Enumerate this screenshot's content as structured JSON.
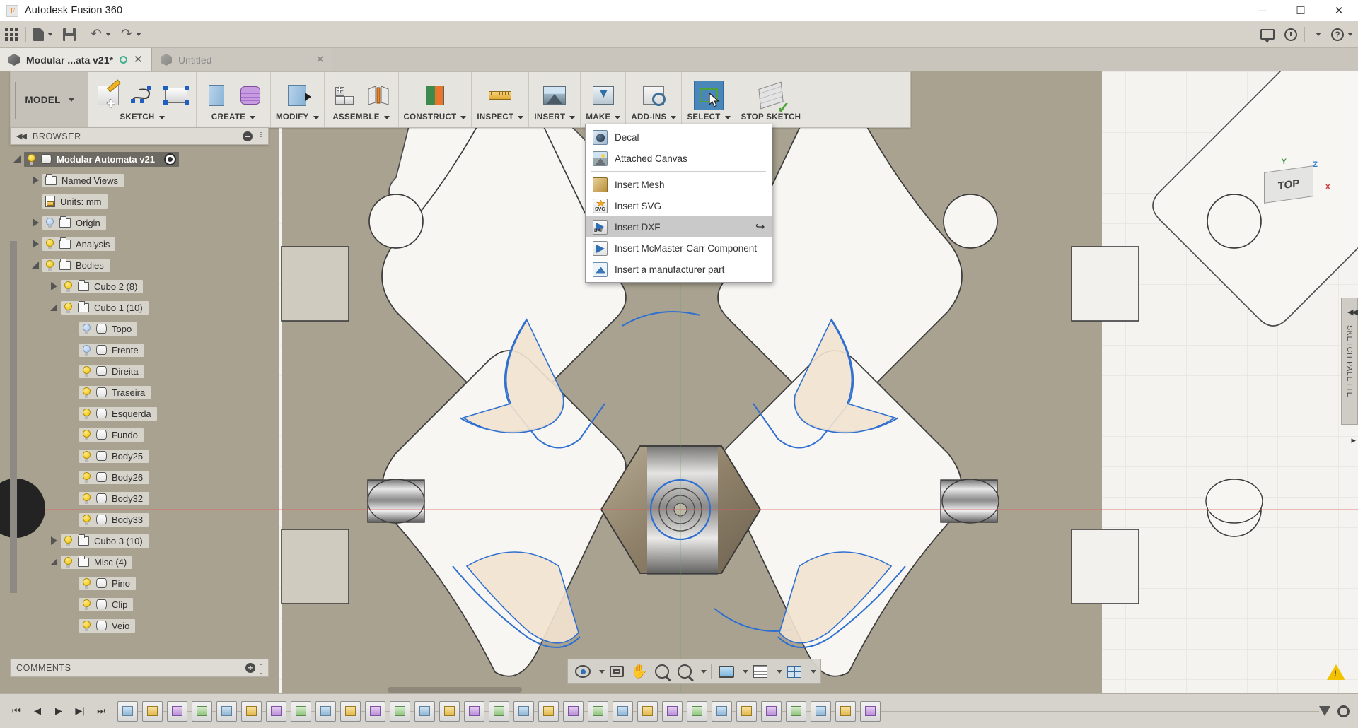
{
  "window": {
    "app_title": "Autodesk Fusion 360",
    "logo_letter": "F",
    "minimize": "─",
    "maximize": "☐",
    "close": "✕"
  },
  "quickbar": {
    "apps_grid": "apps-grid",
    "new_doc": "new-document",
    "save": "save",
    "undo": "undo",
    "redo": "redo",
    "comments_icon": "comments",
    "history_icon": "job-status",
    "user_caret": "▾",
    "help_label": "?",
    "help_caret": "▾"
  },
  "tabs": [
    {
      "label": "Modular ...ata v21*",
      "state": "active",
      "close": "✕",
      "dot": "sync-dot"
    },
    {
      "label": "Untitled",
      "state": "inactive",
      "close": "✕"
    }
  ],
  "ribbon": {
    "workspace": "MODEL",
    "workspace_caret": "▾",
    "groups": [
      {
        "label": "SKETCH",
        "caret": "▾",
        "icons": [
          "create-sketch-icon",
          "spline-icon",
          "rectangle-icon"
        ]
      },
      {
        "label": "CREATE",
        "caret": "▾",
        "icons": [
          "extrude-icon",
          "form-icon"
        ]
      },
      {
        "label": "MODIFY",
        "caret": "▾",
        "icons": [
          "press-pull-icon"
        ]
      },
      {
        "label": "ASSEMBLE",
        "caret": "▾",
        "icons": [
          "new-component-icon",
          "joint-icon"
        ]
      },
      {
        "label": "CONSTRUCT",
        "caret": "▾",
        "icons": [
          "offset-plane-icon"
        ]
      },
      {
        "label": "INSPECT",
        "caret": "▾",
        "icons": [
          "measure-icon"
        ]
      },
      {
        "label": "INSERT",
        "caret": "▾",
        "icons": [
          "insert-icon"
        ]
      },
      {
        "label": "MAKE",
        "caret": "▾",
        "icons": [
          "3d-print-icon"
        ]
      },
      {
        "label": "ADD-INS",
        "caret": "▾",
        "icons": [
          "scripts-addins-icon"
        ]
      },
      {
        "label": "SELECT",
        "caret": "▾",
        "icons": [
          "select-icon"
        ],
        "selected": true
      },
      {
        "label": "STOP SKETCH",
        "caret": "",
        "icons": [
          "stop-sketch-icon"
        ]
      }
    ]
  },
  "insert_menu": {
    "items": [
      {
        "label": "Decal",
        "icon": "decal-icon",
        "highlighted": false,
        "separator_after": false
      },
      {
        "label": "Attached Canvas",
        "icon": "attached-canvas-icon",
        "highlighted": false,
        "separator_after": true
      },
      {
        "label": "Insert Mesh",
        "icon": "insert-mesh-icon",
        "highlighted": false,
        "separator_after": false
      },
      {
        "label": "Insert SVG",
        "icon": "insert-svg-icon",
        "highlighted": false,
        "separator_after": false
      },
      {
        "label": "Insert DXF",
        "icon": "insert-dxf-icon",
        "highlighted": true,
        "separator_after": false,
        "shortcut_glyph": "↩"
      },
      {
        "label": "Insert McMaster-Carr Component",
        "icon": "insert-mcmaster-icon",
        "highlighted": false,
        "separator_after": false
      },
      {
        "label": "Insert a manufacturer part",
        "icon": "insert-manufacturer-icon",
        "highlighted": false,
        "separator_after": false
      }
    ]
  },
  "browser": {
    "title": "BROWSER",
    "collapse_glyph": "◀◀",
    "minimize_glyph": "−",
    "tree": [
      {
        "label": "Modular Automata v21",
        "depth": 0,
        "twisty": "expanded",
        "icon": "component-icon",
        "bulb": "on",
        "root": true,
        "target": true
      },
      {
        "label": "Named Views",
        "depth": 1,
        "twisty": "collapsed",
        "icon": "folder-icon",
        "bulb": "none"
      },
      {
        "label": "Units: mm",
        "depth": 1,
        "twisty": "none",
        "icon": "units-icon",
        "bulb": "none"
      },
      {
        "label": "Origin",
        "depth": 1,
        "twisty": "collapsed",
        "icon": "folder-icon",
        "bulb": "off"
      },
      {
        "label": "Analysis",
        "depth": 1,
        "twisty": "collapsed",
        "icon": "folder-icon",
        "bulb": "on"
      },
      {
        "label": "Bodies",
        "depth": 1,
        "twisty": "expanded",
        "icon": "folder-icon",
        "bulb": "on"
      },
      {
        "label": "Cubo 2 (8)",
        "depth": 2,
        "twisty": "collapsed",
        "icon": "folder-icon",
        "bulb": "on"
      },
      {
        "label": "Cubo 1 (10)",
        "depth": 2,
        "twisty": "expanded",
        "icon": "folder-icon",
        "bulb": "on"
      },
      {
        "label": "Topo",
        "depth": 3,
        "twisty": "none",
        "icon": "body-icon",
        "bulb": "off"
      },
      {
        "label": "Frente",
        "depth": 3,
        "twisty": "none",
        "icon": "body-icon",
        "bulb": "off"
      },
      {
        "label": "Direita",
        "depth": 3,
        "twisty": "none",
        "icon": "body-icon",
        "bulb": "on"
      },
      {
        "label": "Traseira",
        "depth": 3,
        "twisty": "none",
        "icon": "body-icon",
        "bulb": "on"
      },
      {
        "label": "Esquerda",
        "depth": 3,
        "twisty": "none",
        "icon": "body-icon",
        "bulb": "on"
      },
      {
        "label": "Fundo",
        "depth": 3,
        "twisty": "none",
        "icon": "body-icon",
        "bulb": "on"
      },
      {
        "label": "Body25",
        "depth": 3,
        "twisty": "none",
        "icon": "body-icon",
        "bulb": "on"
      },
      {
        "label": "Body26",
        "depth": 3,
        "twisty": "none",
        "icon": "body-icon",
        "bulb": "on"
      },
      {
        "label": "Body32",
        "depth": 3,
        "twisty": "none",
        "icon": "body-icon",
        "bulb": "on"
      },
      {
        "label": "Body33",
        "depth": 3,
        "twisty": "none",
        "icon": "body-icon",
        "bulb": "on"
      },
      {
        "label": "Cubo 3 (10)",
        "depth": 2,
        "twisty": "collapsed",
        "icon": "folder-icon",
        "bulb": "on"
      },
      {
        "label": "Misc (4)",
        "depth": 2,
        "twisty": "expanded",
        "icon": "folder-icon",
        "bulb": "on"
      },
      {
        "label": "Pino",
        "depth": 3,
        "twisty": "none",
        "icon": "body-icon",
        "bulb": "on"
      },
      {
        "label": "Clip",
        "depth": 3,
        "twisty": "none",
        "icon": "body-icon",
        "bulb": "on"
      },
      {
        "label": "Veio",
        "depth": 3,
        "twisty": "none",
        "icon": "body-icon",
        "bulb": "on"
      }
    ]
  },
  "comments": {
    "title": "COMMENTS",
    "add_glyph": "+"
  },
  "viewcube": {
    "face_label": "TOP",
    "axis_x": "X",
    "axis_y": "Y",
    "axis_z": "Z"
  },
  "sketch_palette": {
    "label": "SKETCH PALETTE",
    "collapse_glyph": "◀◀",
    "expand_glyph": "▸"
  },
  "navbar": {
    "buttons": [
      {
        "name": "orbit-icon",
        "caret": "▾"
      },
      {
        "name": "look-at-icon",
        "caret": ""
      },
      {
        "name": "pan-icon",
        "caret": ""
      },
      {
        "name": "zoom-icon",
        "caret": ""
      },
      {
        "name": "zoom-window-icon",
        "caret": "▾"
      },
      {
        "name": "display-settings-icon",
        "caret": "▾"
      },
      {
        "name": "grid-snaps-icon",
        "caret": "▾"
      },
      {
        "name": "viewports-icon",
        "caret": "▾"
      }
    ]
  },
  "timeline": {
    "playback": [
      "go-to-beginning",
      "step-back",
      "play",
      "step-forward",
      "go-to-end"
    ],
    "feature_count": 31,
    "marker_glyph": "▼",
    "settings_glyph": "gear"
  },
  "colors": {
    "accent_blue": "#4a86b8",
    "viewport_bg": "#a9a290",
    "ribbon_bg": "#e6e4df",
    "panel_bg": "#dedbd4",
    "highlight_menu": "#c9c9c9",
    "sketch_blue": "#2f6fd0",
    "warning": "#f2c200"
  },
  "warning_badge": {
    "glyph": "!"
  }
}
